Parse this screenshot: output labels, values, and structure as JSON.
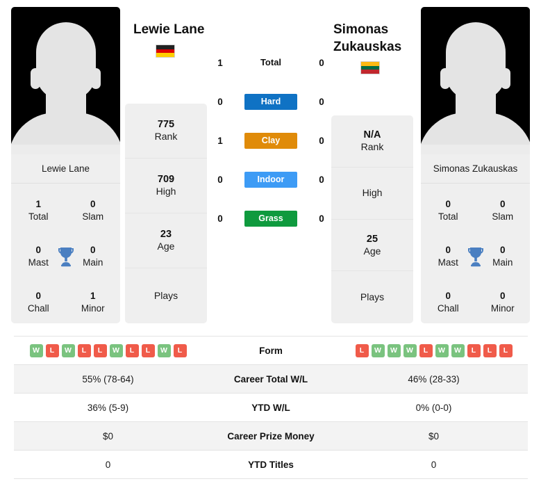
{
  "players": {
    "left": {
      "name": "Lewie Lane",
      "flag_name": "germany-flag",
      "flag_colors": [
        "#222222",
        "#dd0000",
        "#ffce00"
      ],
      "card_name": "Lewie Lane",
      "titles": [
        {
          "value": "1",
          "label": "Total"
        },
        {
          "value": "0",
          "label": "Slam"
        },
        {
          "value": "0",
          "label": "Mast"
        },
        {
          "value": "0",
          "label": "Main"
        },
        {
          "value": "0",
          "label": "Chall"
        },
        {
          "value": "1",
          "label": "Minor"
        }
      ],
      "info": [
        {
          "value": "775",
          "label": "Rank"
        },
        {
          "value": "709",
          "label": "High"
        },
        {
          "value": "23",
          "label": "Age"
        },
        {
          "value": "",
          "label": "Plays"
        }
      ]
    },
    "right": {
      "name": "Simonas Zukauskas",
      "name_line1": "Simonas",
      "name_line2": "Zukauskas",
      "flag_name": "lithuania-flag",
      "flag_colors": [
        "#fdb913",
        "#006a44",
        "#c1272d"
      ],
      "card_name": "Simonas Zukauskas",
      "titles": [
        {
          "value": "0",
          "label": "Total"
        },
        {
          "value": "0",
          "label": "Slam"
        },
        {
          "value": "0",
          "label": "Mast"
        },
        {
          "value": "0",
          "label": "Main"
        },
        {
          "value": "0",
          "label": "Chall"
        },
        {
          "value": "0",
          "label": "Minor"
        }
      ],
      "info": [
        {
          "value": "N/A",
          "label": "Rank"
        },
        {
          "value": "",
          "label": "High"
        },
        {
          "value": "25",
          "label": "Age"
        },
        {
          "value": "",
          "label": "Plays"
        }
      ]
    }
  },
  "head_to_head": [
    {
      "left": "1",
      "surface": "Total",
      "right": "0",
      "style": "plain",
      "color": ""
    },
    {
      "left": "0",
      "surface": "Hard",
      "right": "0",
      "style": "pill",
      "color": "#0f72c4"
    },
    {
      "left": "1",
      "surface": "Clay",
      "right": "0",
      "style": "pill",
      "color": "#e08b09"
    },
    {
      "left": "0",
      "surface": "Indoor",
      "right": "0",
      "style": "pill",
      "color": "#3d9bf5"
    },
    {
      "left": "0",
      "surface": "Grass",
      "right": "0",
      "style": "pill",
      "color": "#0f9a3e"
    }
  ],
  "comparison": {
    "form": {
      "label": "Form",
      "left": [
        "W",
        "L",
        "W",
        "L",
        "L",
        "W",
        "L",
        "L",
        "W",
        "L"
      ],
      "right": [
        "L",
        "W",
        "W",
        "W",
        "L",
        "W",
        "W",
        "L",
        "L",
        "L"
      ]
    },
    "rows": [
      {
        "label": "Career Total W/L",
        "left": "55% (78-64)",
        "right": "46% (28-33)",
        "shaded": true
      },
      {
        "label": "YTD W/L",
        "left": "36% (5-9)",
        "right": "0% (0-0)",
        "shaded": false
      },
      {
        "label": "Career Prize Money",
        "left": "$0",
        "right": "$0",
        "shaded": true
      },
      {
        "label": "YTD Titles",
        "left": "0",
        "right": "0",
        "shaded": false
      }
    ]
  },
  "colors": {
    "win": "#7ac37f",
    "loss": "#f05b4a",
    "trophy": "#4a7fc1",
    "card_bg": "#efefef"
  }
}
